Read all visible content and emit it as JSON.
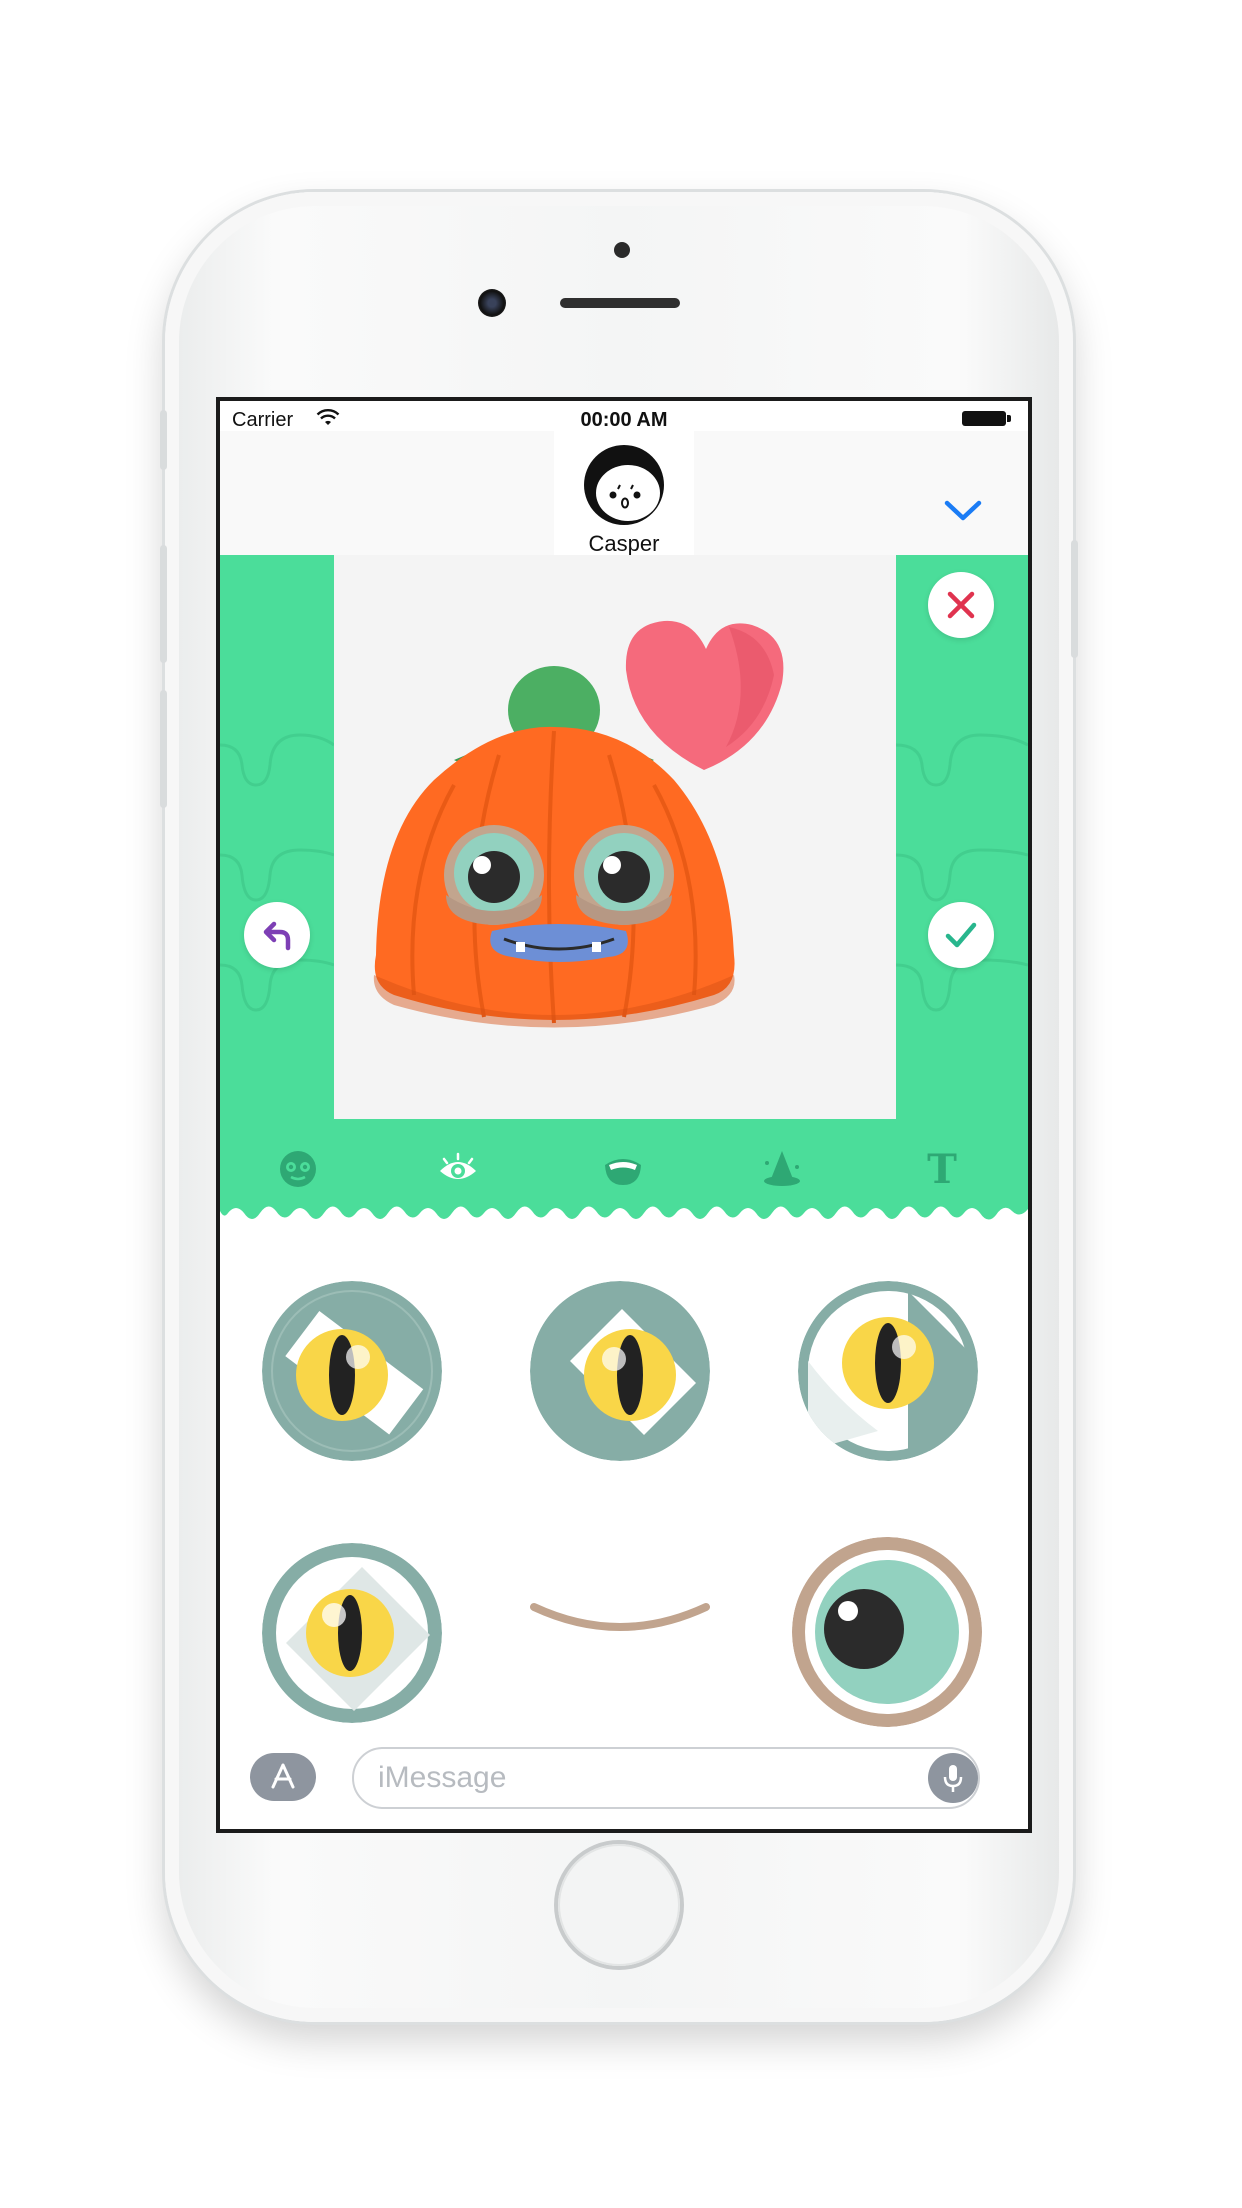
{
  "status": {
    "carrier": "Carrier",
    "time": "00:00 AM"
  },
  "nav": {
    "contact_name": "Casper"
  },
  "toolbar": {
    "tools": [
      "face-icon",
      "eye-icon",
      "mouth-icon",
      "hat-icon",
      "text-icon"
    ],
    "text_tool_glyph": "T"
  },
  "input": {
    "placeholder": "iMessage"
  },
  "colors": {
    "green": "#4bdd9a",
    "pumpkin": "#ff6a22",
    "heart": "#f56a7c",
    "close_red": "#e0334f",
    "check_teal": "#28b68d",
    "back_purple": "#7d3fb5",
    "nav_blue": "#1b7cf5"
  }
}
